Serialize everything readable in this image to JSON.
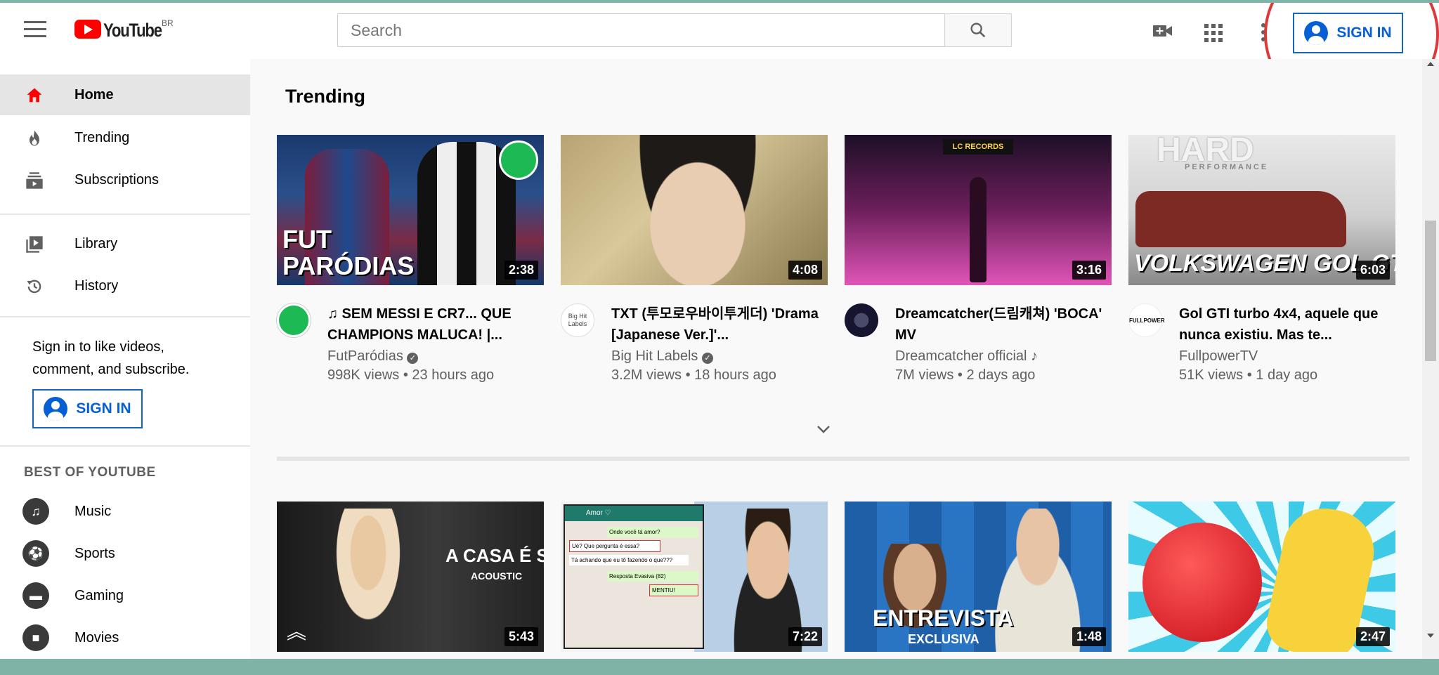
{
  "header": {
    "logo_text": "YouTube",
    "region": "BR",
    "search_placeholder": "Search",
    "signin_label": "SIGN IN"
  },
  "sidebar": {
    "items": [
      {
        "label": "Home",
        "icon": "home-icon"
      },
      {
        "label": "Trending",
        "icon": "trending-icon"
      },
      {
        "label": "Subscriptions",
        "icon": "subscriptions-icon"
      },
      {
        "label": "Library",
        "icon": "library-icon"
      },
      {
        "label": "History",
        "icon": "history-icon"
      }
    ],
    "signin_prompt": "Sign in to like videos, comment, and subscribe.",
    "signin_label": "SIGN IN",
    "best_of_title": "BEST OF YOUTUBE",
    "categories": [
      {
        "label": "Music",
        "icon": "music-icon"
      },
      {
        "label": "Sports",
        "icon": "sports-icon"
      },
      {
        "label": "Gaming",
        "icon": "gaming-icon"
      },
      {
        "label": "Movies",
        "icon": "movies-icon"
      }
    ]
  },
  "main": {
    "section_title": "Trending",
    "videos": [
      {
        "title": "♫ SEM MESSI E CR7... QUE CHAMPIONS MALUCA! |...",
        "channel": "FutParódias",
        "stats": "998K views • 23 hours ago",
        "duration": "2:38",
        "verified": true,
        "thumb_text": "FUT PARÓDIAS"
      },
      {
        "title": "TXT (투모로우바이투게더) 'Drama [Japanese Ver.]'...",
        "channel": "Big Hit Labels",
        "stats": "3.2M views • 18 hours ago",
        "duration": "4:08",
        "verified": true,
        "avatar_text": "Big Hit Labels"
      },
      {
        "title": "Dreamcatcher(드림캐쳐) 'BOCA' MV",
        "channel": "Dreamcatcher official ♪",
        "stats": "7M views • 2 days ago",
        "duration": "3:16",
        "verified": false,
        "thumb_text": "LC RECORDS"
      },
      {
        "title": "Gol GTI turbo 4x4, aquele que nunca existiu. Mas te...",
        "channel": "FullpowerTV",
        "stats": "51K views • 1 day ago",
        "duration": "6:03",
        "verified": false,
        "thumb_text": "VOLKSWAGEN GOL GTI",
        "thumb_text_2": "HARD",
        "thumb_text_3": "PERFORMANCE",
        "avatar_text": "FULLPOWER"
      }
    ],
    "videos_row2": [
      {
        "duration": "5:43",
        "thumb_text": "A CASA É SUA",
        "thumb_sub": "ACOUSTIC"
      },
      {
        "duration": "7:22",
        "chat_name": "Amor ♡",
        "chat_lines": [
          "Onde você tá amor?",
          "Ué? Que pergunta é essa?",
          "Tá achando que eu tô fazendo o que???",
          "Resposta Evasiva (82)",
          "MENTIU!"
        ]
      },
      {
        "duration": "1:48",
        "thumb_text": "ENTREVISTA",
        "thumb_sub": "EXCLUSIVA"
      },
      {
        "duration": "2:47"
      }
    ]
  }
}
